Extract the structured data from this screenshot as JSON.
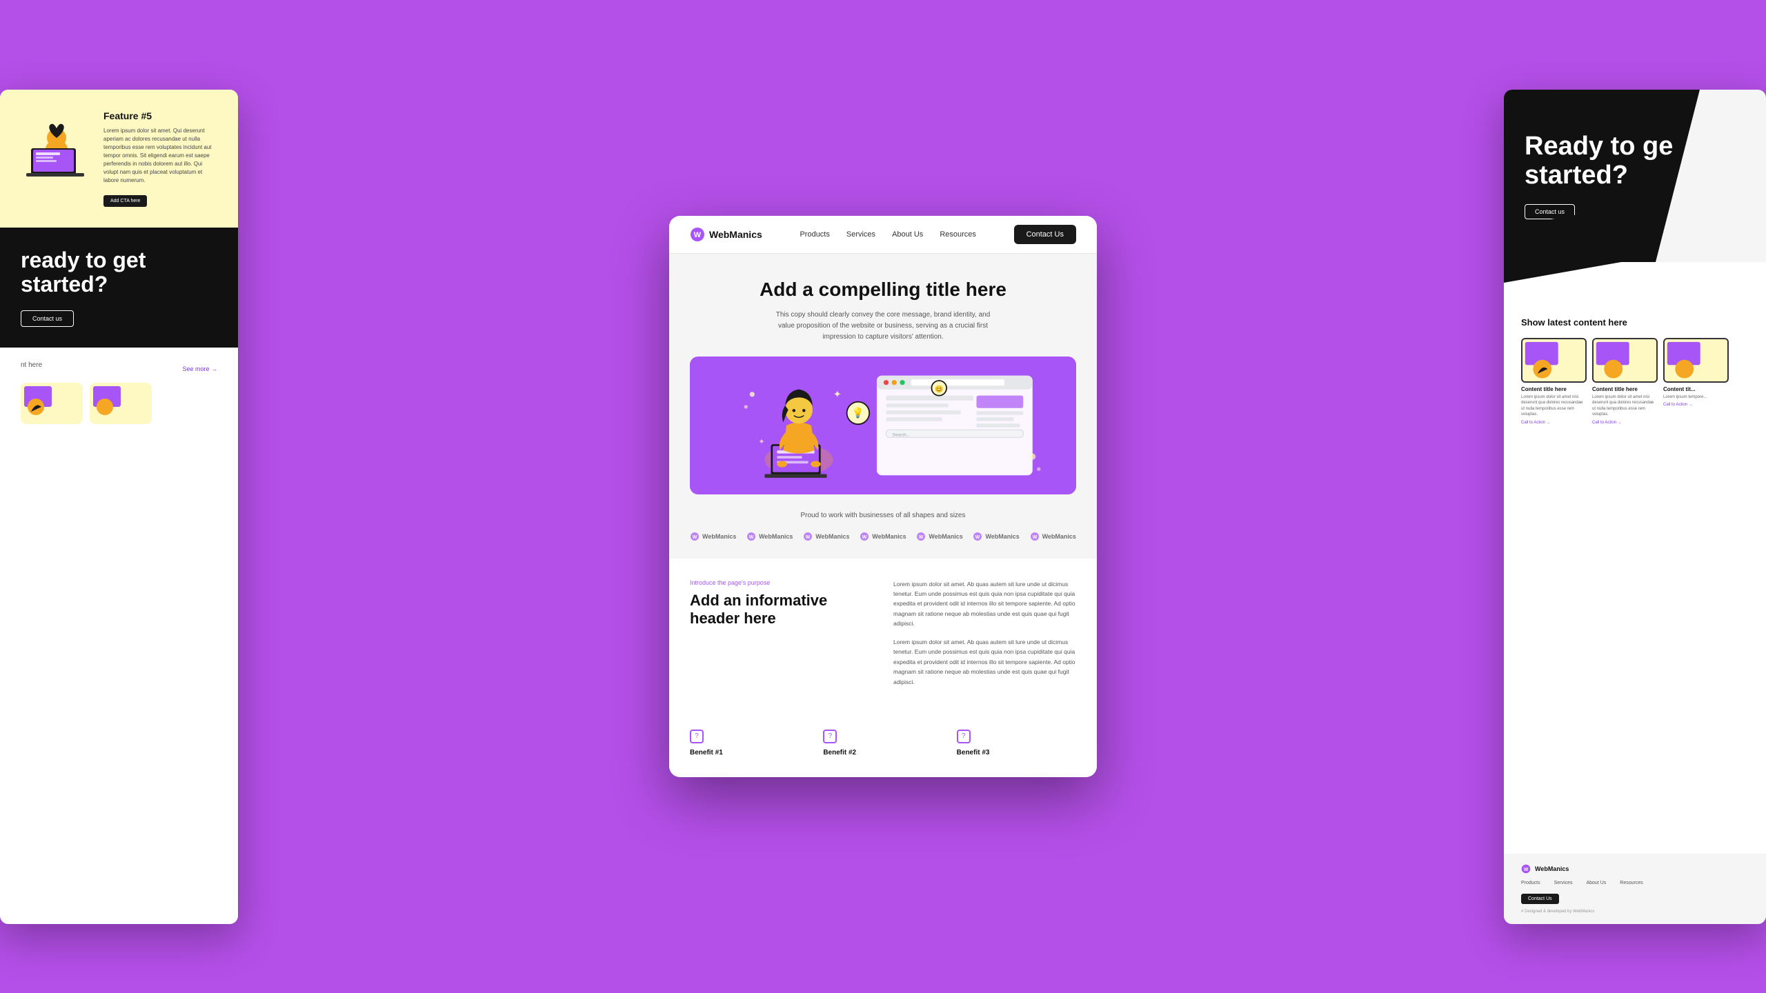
{
  "page": {
    "background_color": "#b44fe8"
  },
  "navbar": {
    "logo_text": "WebManics",
    "nav_items": [
      "Products",
      "Services",
      "About Us",
      "Resources"
    ],
    "contact_button": "Contact Us"
  },
  "hero": {
    "title": "Add a compelling title here",
    "subtitle": "This copy should clearly convey the core message, brand identity, and value proposition of the website or business, serving as a crucial first impression to capture visitors' attention."
  },
  "logos": {
    "tagline": "Proud to work with businesses of all shapes and sizes",
    "items": [
      "WebManics",
      "WebManics",
      "WebManics",
      "WebManics",
      "WebManics",
      "WebManics",
      "WebManics"
    ]
  },
  "features": {
    "intro_label": "Introduce the page's purpose",
    "header": "Add an informative header here",
    "body_text_1": "Lorem ipsum dolor sit amet. Ab quas autem sit lure unde ut dicimus tenetur. Eum unde possimus est quis quia non ipsa cupiditate qui quia expedita et provident odit id internos illo sit tempore sapiente. Ad optio magnam sit ratione neque ab molestias unde est quis quae qui fugit adipisci.",
    "body_text_2": "Lorem ipsum dolor sit amet. Ab quas autem sit lure unde ut dicimus tenetur. Eum unde possimus est quis quia non ipsa cupiditate qui quia expedita et provident odit id internos illo sit tempore sapiente. Ad optio magnam sit ratione neque ab molestias unde est quis quae qui fugit adipisci."
  },
  "benefits": {
    "items": [
      {
        "title": "Benefit #1",
        "icon": "?"
      },
      {
        "title": "Benefit #2",
        "icon": "?"
      },
      {
        "title": "Benefit #3",
        "icon": "?"
      }
    ]
  },
  "left_panel": {
    "feature_title": "Feature #5",
    "feature_text": "Lorem ipsum dolor sit amet. Qui deserunt aperiam ac dolores recusandae ut nulla temporibus esse rem voluptates incidunt aut tempor omnis. Sit eligendi earum est saepe perferendis in nobis dolorem aut illo. Qui volupt nam quis et placeat voluptatum et labore numerum.",
    "cta_button": "Add CTA here",
    "black_title": "ready to get started?",
    "black_btn": "Contact us",
    "content_label": "nt here",
    "see_more": "See more →"
  },
  "right_panel": {
    "black_title": "Ready to ge started?",
    "black_btn": "Contact us",
    "content_title": "Show latest content here",
    "cards": [
      {
        "title": "Content title here",
        "text": "Lorem ipsum dolor sit amet nisi deserunt qua dolores recusandae ut nulla temporibus esse rem voluptas.",
        "cta": "Call to Action →"
      },
      {
        "title": "Content title here",
        "text": "Lorem ipsum dolor sit amet nisi deserunt qua dolores recusandae ut nulla temporibus esse rem voluptas.",
        "cta": "Call to Action →"
      },
      {
        "title": "Content tit...",
        "text": "Lorem ipsum tempore...",
        "cta": "Call to Action →"
      }
    ],
    "footer_logo": "WebManics",
    "footer_nav": [
      "Products",
      "Services",
      "About Us",
      "Resources"
    ],
    "footer_contact_btn": "Contact Us",
    "footer_credit": "# Designed & developed by WebManics"
  }
}
